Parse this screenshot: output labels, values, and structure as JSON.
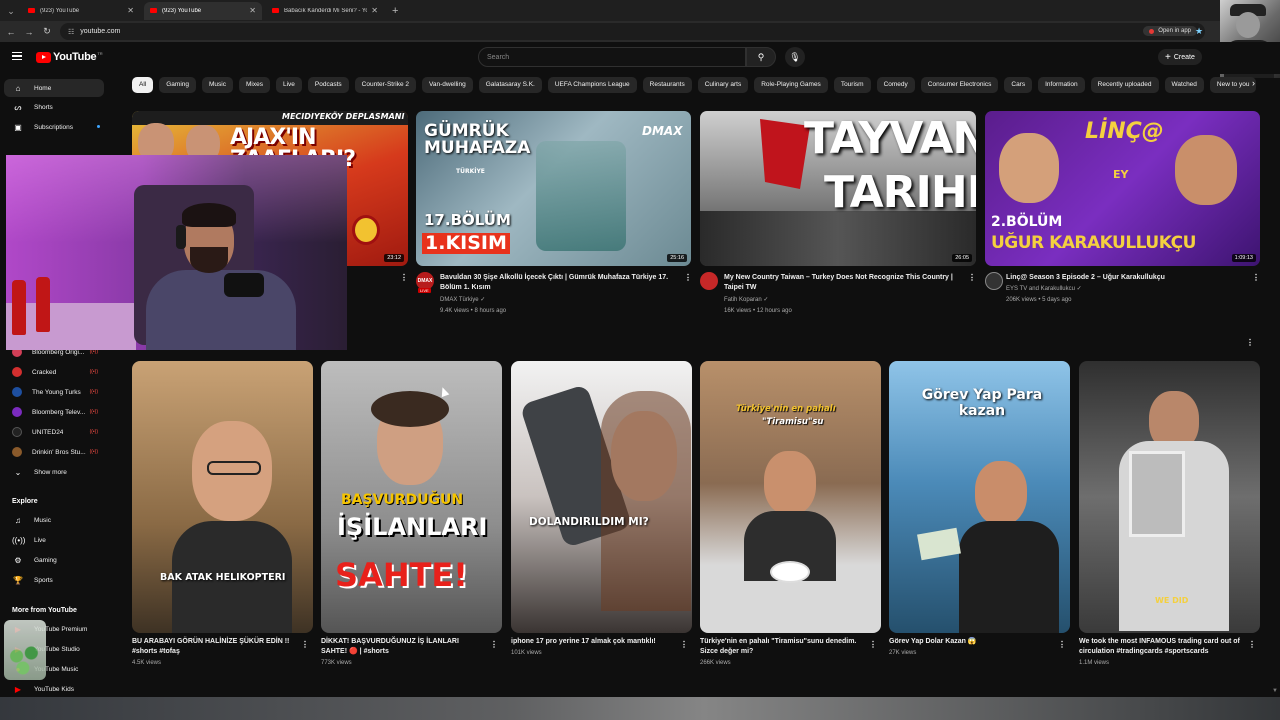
{
  "browser": {
    "tabs": [
      {
        "title": "(923) YouTube",
        "active": false
      },
      {
        "title": "(923) YouTube",
        "active": true
      },
      {
        "title": "Babacık Kanderdi Mı Seni? - Yo...",
        "active": false
      }
    ],
    "url": "youtube.com",
    "open_in_app": "Open in app"
  },
  "masthead": {
    "logo_text": "YouTube",
    "country": "TR",
    "search_placeholder": "Search",
    "create_label": "Create"
  },
  "chips": [
    "All",
    "Gaming",
    "Music",
    "Mixes",
    "Live",
    "Podcasts",
    "Counter-Strike 2",
    "Van-dwelling",
    "Galatasaray S.K.",
    "UEFA Champions League",
    "Restaurants",
    "Culinary arts",
    "Role-Playing Games",
    "Tourism",
    "Comedy",
    "Consumer Electronics",
    "Cars",
    "Information",
    "Recently uploaded",
    "Watched",
    "New to you"
  ],
  "sidebar": {
    "main": [
      {
        "label": "Home",
        "icon": "home-icon"
      },
      {
        "label": "Shorts",
        "icon": "shorts-icon"
      },
      {
        "label": "Subscriptions",
        "icon": "subscriptions-icon"
      }
    ],
    "channels": [
      {
        "label": "Bloomberg Origi...",
        "color": "#d23f57"
      },
      {
        "label": "Cracked",
        "color": "#d32f2f"
      },
      {
        "label": "The Young Turks",
        "color": "#1e4fa0"
      },
      {
        "label": "Bloomberg Telev...",
        "color": "#7b2bbf"
      },
      {
        "label": "UNITED24",
        "color": "#222222"
      },
      {
        "label": "Drinkin' Bros Stu...",
        "color": "#8a5a2b"
      }
    ],
    "show_more": "Show more",
    "explore_title": "Explore",
    "explore": [
      {
        "label": "Music",
        "icon": "music-icon"
      },
      {
        "label": "Live",
        "icon": "live-icon"
      },
      {
        "label": "Gaming",
        "icon": "gaming-icon"
      },
      {
        "label": "Sports",
        "icon": "trophy-icon"
      }
    ],
    "more_title": "More from YouTube",
    "more": [
      {
        "label": "YouTube Premium"
      },
      {
        "label": "YouTube Studio"
      },
      {
        "label": "YouTube Music"
      },
      {
        "label": "YouTube Kids"
      }
    ]
  },
  "videos": [
    {
      "thumb_top": "MECIDIYEKÖY DEPLASMANI",
      "thumb_text": "AJAX'IN ZAAFLARI?",
      "duration": "23:12"
    },
    {
      "thumb_text_1": "GÜMRÜK MUHAFAZA",
      "thumb_text_2": "TÜRKİYE",
      "thumb_text_3": "17.BÖLÜM",
      "thumb_text_4": "1.KISIM",
      "thumb_logo": "DMAX",
      "duration": "25:16",
      "title": "Bavuldan 30 Şişe Alkollü İçecek Çıktı | Gümrük Muhafaza Türkiye 17. Bölüm 1. Kısım",
      "channel": "DMAX Türkiye",
      "meta": "9.4K views • 8 hours ago",
      "avatar_text": "DMAX",
      "live_badge": "LIVE"
    },
    {
      "thumb_text_1": "TAYVAN",
      "thumb_text_2": "TARIHI",
      "duration": "26:05",
      "title": "My New Country Taiwan – Turkey Does Not Recognize This Country | Taipei TW",
      "channel": "Fatih Koparan",
      "meta": "16K views • 12 hours ago"
    },
    {
      "thumb_text_1": "LİNÇ@",
      "thumb_text_2": "2.BÖLÜM",
      "thumb_text_3": "UĞUR KARAKULLUKÇU",
      "thumb_logo": "EY",
      "duration": "1:09:13",
      "title": "Linç@ Season 3 Episode 2 – Uğur Karakullukçu",
      "channel": "EYS TV and Karakullukcu",
      "meta": "206K views • 5 days ago"
    }
  ],
  "shorts": [
    {
      "title": "BU ARABAYI GÖRÜN HALİNİZE ŞÜKÜR EDİN !! #shorts #tofaş",
      "views": "4.5K views",
      "caption": "BAK ATAK HELIKOPTERI"
    },
    {
      "title": "DİKKAT! BAŞVURDUĞUNUZ İŞ İLANLARI SAHTE! 🔴 | #shorts",
      "views": "773K views",
      "caption_1": "BAŞVURDUĞUN",
      "caption_2": "İŞİLANLARI",
      "caption_3": "SAHTE!"
    },
    {
      "title": "iphone 17 pro yerine 17 almak çok mantıklı!",
      "views": "101K views",
      "caption": "DOLANDIRILDIM MI?"
    },
    {
      "title": "Türkiye'nin en pahalı \"Tiramisu\"sunu denedim. Sizce değer mi?",
      "views": "266K views",
      "caption_1": "Türkiye'nin en pahalı",
      "caption_2": "\"Tiramisu\"su"
    },
    {
      "title": "Görev Yap Dolar Kazan 😱",
      "views": "27K views",
      "caption": "Görev Yap Para kazan"
    },
    {
      "title": "We took the most INFAMOUS trading card out of circulation #tradingcards #sportscards",
      "views": "1.1M views",
      "caption": "WE DID"
    }
  ]
}
